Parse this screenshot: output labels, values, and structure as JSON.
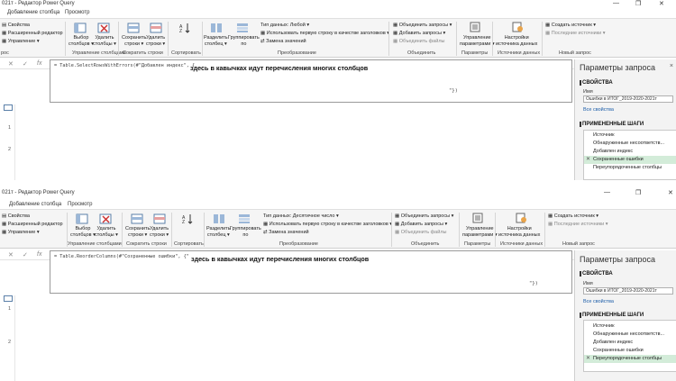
{
  "w1": {
    "title": "021т - Редактор Power Query",
    "tabs": [
      "Добавление столбца",
      "Просмотр"
    ],
    "left_items": [
      "Свойства",
      "Расширенный редактор",
      "Управление ▾"
    ],
    "ribbon_items": [
      {
        "label": "Выбор\nстолбцов ▾"
      },
      {
        "label": "Удалить\nстолбцы ▾"
      },
      {
        "label": "Сохранить\nстроки ▾"
      },
      {
        "label": "Удалить\nстроки ▾"
      },
      {
        "label": "Разделить\nстолбец ▾"
      },
      {
        "label": "Группировать\nпо"
      }
    ],
    "transform_lines": [
      "Тип данных: Любой ▾",
      "Использовать первую строку в качестве заголовков ▾",
      "Замена значений"
    ],
    "combine_lines": [
      "Объединить запросы ▾",
      "Добавить запросы ▾",
      "Объединить файлы"
    ],
    "params_label": "Управление\nпараметрами ▾",
    "ds_label": "Настройки\nисточника данных",
    "new_lines": [
      "Создать источник ▾",
      "Последние источники ▾"
    ],
    "groups": [
      "рос",
      "Управление столбцами",
      "Сократить строки",
      "Сортировать",
      "Преобразование",
      "Объединить",
      "Параметры",
      "Источники данных",
      "Новый запрос"
    ],
    "formula_btns": [
      "✕",
      "✓",
      "fx"
    ],
    "code": "= Table.SelectRowsWithErrors(#\"Добавлен индекс\", {",
    "note": "здесь в кавычках идут перечисления многих столбцов",
    "tail": "\"})",
    "rows": [
      "1",
      "2"
    ],
    "panel": {
      "title": "Параметры запроса",
      "close": "×",
      "props": "СВОЙСТВА",
      "name_label": "Имя",
      "name_value": "Ошибки в ИТОГ_2019-2020-2021т",
      "all_props": "Все свойства",
      "steps_title": "ПРИМЕНЕННЫЕ ШАГИ",
      "steps": [
        "Источник",
        "Обнаруженные несоответств...",
        "Добавлен индекс",
        "Сохраненные ошибки",
        "Переупорядоченные столбцы"
      ],
      "selected": 3
    }
  },
  "w2": {
    "title": "021т - Редактор Power Query",
    "tabs": [
      "Добавление столбца",
      "Просмотр"
    ],
    "left_items": [
      "Свойства",
      "Расширенный редактор",
      "Управление ▾"
    ],
    "ribbon_items": [
      {
        "label": "Выбор\nстолбцов ▾"
      },
      {
        "label": "Удалить\nстолбцы ▾"
      },
      {
        "label": "Сохранить\nстроки ▾"
      },
      {
        "label": "Удалить\nстроки ▾"
      },
      {
        "label": "Разделить\nстолбец ▾"
      },
      {
        "label": "Группировать\nпо"
      }
    ],
    "transform_lines": [
      "Тип данных: Десятичное число ▾",
      "Использовать первую строку в качестве заголовков ▾",
      "Замена значений"
    ],
    "combine_lines": [
      "Объединить запросы ▾",
      "Добавить запросы ▾",
      "Объединить файлы"
    ],
    "params_label": "Управление\nпараметрами ▾",
    "ds_label": "Настройки\nисточника данных",
    "new_lines": [
      "Создать источник ▾",
      "Последние источники ▾"
    ],
    "groups": [
      "Управление столбцами",
      "Сократить строки",
      "Сортировать",
      "Преобразование",
      "Объединить",
      "Параметры",
      "Источники данных",
      "Новый запрос"
    ],
    "formula_btns": [
      "✕",
      "✓",
      "fx"
    ],
    "code": "= Table.ReorderColumns(#\"Сохраненные ошибки\", {\"",
    "note": "здесь в кавычках идут перечисления многих столбцов",
    "tail": "\"})",
    "rows": [
      "1",
      "2"
    ],
    "panel": {
      "title": "Параметры запроса",
      "close": "×",
      "props": "СВОЙСТВА",
      "name_label": "Имя",
      "name_value": "Ошибки в ИТОГ_2019-2020-2021т",
      "all_props": "Все свойства",
      "steps_title": "ПРИМЕНЕННЫЕ ШАГИ",
      "steps": [
        "Источник",
        "Обнаруженные несоответств...",
        "Добавлен индекс",
        "Сохраненные ошибки",
        "Переупорядоченные столбцы"
      ],
      "selected": 4
    }
  },
  "colors": {
    "accent": "#1a5ca8",
    "selected_step": "#d3ecd9",
    "ribbon_bg": "#f5f5f5",
    "panel_bg": "#f3f3f3"
  }
}
